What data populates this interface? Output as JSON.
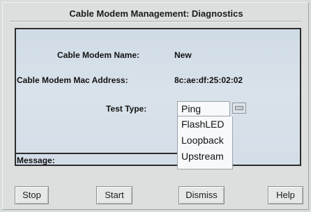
{
  "dialog": {
    "title": "Cable Modem Management: Diagnostics"
  },
  "fields": {
    "name_label": "Cable Modem Name:",
    "name_value": "New",
    "mac_label": "Cable Modem Mac Address:",
    "mac_value": "8c:ae:df:25:02:02",
    "test_type_label": "Test Type:",
    "test_type_value": "Ping",
    "test_type_options": [
      "FlashLED",
      "Loopback",
      "Upstream"
    ]
  },
  "message": {
    "label": "Message:"
  },
  "buttons": {
    "stop": "Stop",
    "start": "Start",
    "dismiss": "Dismiss",
    "help": "Help"
  },
  "colors": {
    "panel_bg": "#d4dee8",
    "dialog_bg": "#dddfdf"
  }
}
